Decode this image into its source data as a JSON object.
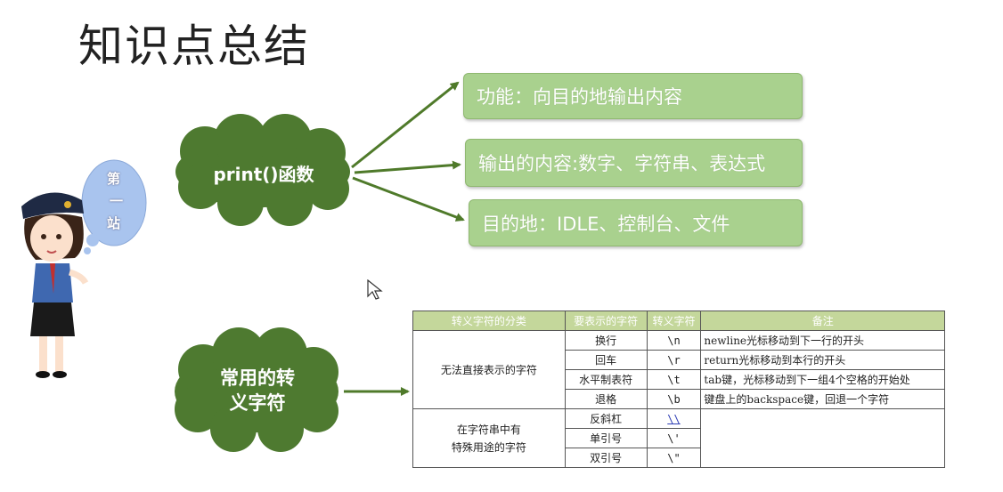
{
  "title": "知识点总结",
  "bubble": {
    "chars": [
      "第",
      "一",
      "站"
    ]
  },
  "cloud_print": "print()函数",
  "cloud_escape": [
    "常用的转",
    "义字符"
  ],
  "boxes": [
    "功能：向目的地输出内容",
    "输出的内容:数字、字符串、表达式",
    "目的地：IDLE、控制台、文件"
  ],
  "table": {
    "headers": [
      "转义字符的分类",
      "要表示的字符",
      "转义字符",
      "备注"
    ],
    "group1": "无法直接表示的字符",
    "group2_line1": "在字符串中有",
    "group2_line2": "特殊用途的字符",
    "rows": [
      {
        "char": "换行",
        "esc": "\\n",
        "note": "newline光标移动到下一行的开头"
      },
      {
        "char": "回车",
        "esc": "\\r",
        "note": "return光标移动到本行的开头"
      },
      {
        "char": "水平制表符",
        "esc": "\\t",
        "note": "tab键，光标移动到下一组4个空格的开始处"
      },
      {
        "char": "退格",
        "esc": "\\b",
        "note": "键盘上的backspace键，回退一个字符"
      },
      {
        "char": "反斜杠",
        "esc": "\\\\",
        "note": ""
      },
      {
        "char": "单引号",
        "esc": "\\'",
        "note": ""
      },
      {
        "char": "双引号",
        "esc": "\\\"",
        "note": ""
      }
    ]
  },
  "colors": {
    "box": "#a9d18e",
    "cloud": "#4e7a30",
    "arrow": "#4f7a2a",
    "header": "#c4d79b"
  }
}
